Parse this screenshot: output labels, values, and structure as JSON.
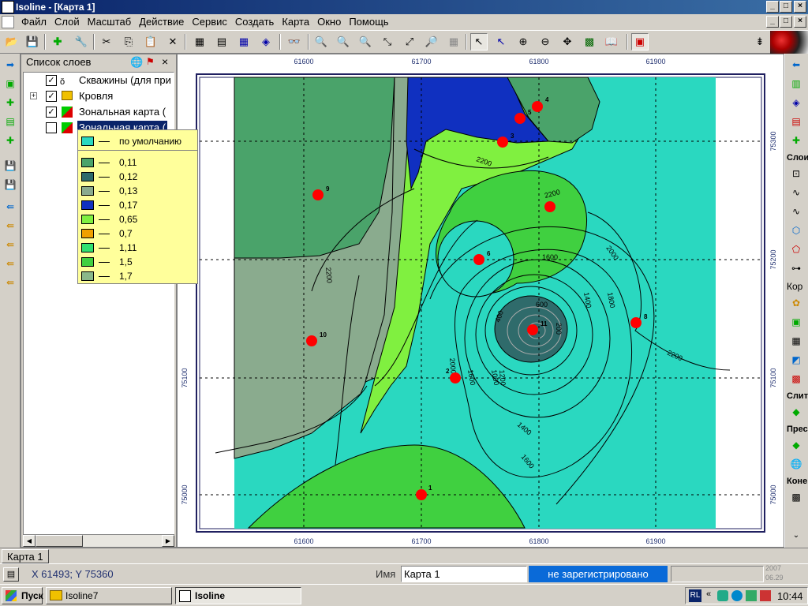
{
  "window": {
    "title": "Isoline - [Карта 1]"
  },
  "menu": [
    "Файл",
    "Слой",
    "Масштаб",
    "Действие",
    "Сервис",
    "Создать",
    "Карта",
    "Окно",
    "Помощь"
  ],
  "layers_panel": {
    "title": "Список слоев",
    "items": [
      {
        "label": "Скважины (для при",
        "checked": true
      },
      {
        "label": "Кровля",
        "checked": true
      },
      {
        "label": "Зональная карта (",
        "checked": true
      },
      {
        "label": "Зональная карта (",
        "checked": false,
        "selected": true
      }
    ]
  },
  "legend": {
    "default_label": "по умолчанию",
    "entries": [
      {
        "label": "0,11",
        "color": "#4aa36a"
      },
      {
        "label": "0,12",
        "color": "#2f6b6b"
      },
      {
        "label": "0,13",
        "color": "#8aab8e"
      },
      {
        "label": "0,17",
        "color": "#1030c0"
      },
      {
        "label": "0,65",
        "color": "#80f040"
      },
      {
        "label": "0,7",
        "color": "#f0a000"
      },
      {
        "label": "1,11",
        "color": "#30e070"
      },
      {
        "label": "1,5",
        "color": "#40d040"
      },
      {
        "label": "1,7",
        "color": "#8ab88a"
      }
    ],
    "default_color": "#2ad8c0"
  },
  "map": {
    "x_ticks": [
      "61600",
      "61700",
      "61800",
      "61900"
    ],
    "y_ticks": [
      "75300",
      "75200",
      "75100",
      "75000"
    ],
    "contour_labels": [
      "2200",
      "2200",
      "2000",
      "1800",
      "1600",
      "1400",
      "1200",
      "1000",
      "800",
      "600",
      "400",
      "200",
      "1400",
      "1600",
      "2200",
      "2200",
      "2000",
      "1800",
      "1400",
      "2000",
      "1600",
      "1000",
      "1200"
    ],
    "wells": [
      "1",
      "2",
      "3",
      "4",
      "5",
      "6",
      "8",
      "9",
      "10",
      "11"
    ]
  },
  "right_toolbar": {
    "labels": [
      "Слои",
      "Кор",
      "Слит",
      "Прес",
      "Коне"
    ]
  },
  "doc_tab": "Карта 1",
  "status": {
    "coords": "X 61493;  Y 75360",
    "name_label": "Имя",
    "name_value": "Карта 1",
    "registration": "не зарегистрировано",
    "year": "2007",
    "date": "06.29"
  },
  "taskbar": {
    "start": "Пуск",
    "items": [
      "Isoline7",
      "Isoline"
    ],
    "lang": "RL",
    "time": "10:44"
  }
}
